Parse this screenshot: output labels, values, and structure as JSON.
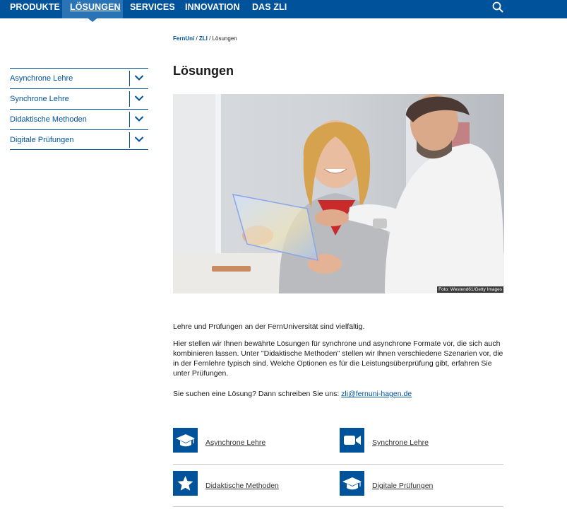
{
  "nav": {
    "items": [
      "PRODUKTE",
      "LÖSUNGEN",
      "SERVICES",
      "INNOVATION",
      "DAS ZLI"
    ],
    "active_index": 1,
    "search_icon": "search-icon",
    "bar_color": "#00529b",
    "active_color": "#2a74b5"
  },
  "breadcrumb": {
    "link1": "FernUni",
    "sep1": " / ",
    "link2": "ZLI",
    "sep2": " / ",
    "current": "Lösungen"
  },
  "sidebar": {
    "items": [
      {
        "label": "Asynchrone Lehre",
        "icon": "chevron-down-icon"
      },
      {
        "label": "Synchrone Lehre",
        "icon": "chevron-down-icon"
      },
      {
        "label": "Didaktische Methoden",
        "icon": "chevron-down-icon"
      },
      {
        "label": "Digitale Prüfungen",
        "icon": "chevron-down-icon"
      }
    ]
  },
  "main": {
    "title": "Lösungen",
    "image_caption": "Foto: Westend61/Getty Images",
    "intro": "Lehre und Prüfungen an der FernUniversität sind vielfältig.",
    "paragraph": "Hier stellen wir Ihnen bewährte Lösungen für synchrone und asynchrone Formate vor, die sich auch kombinieren lassen. Unter \"Didaktische Methoden\" stellen wir Ihnen verschiedene Szenarien vor, die in der Fernlehre typisch sind. Welche Optionen es für die Leistungsüberprüfung gibt, erfahren Sie unter Prüfungen.",
    "contact_prefix": "Sie suchen eine Lösung? Dann schreiben Sie uns: ",
    "contact_email": "zli@fernuni-hagen.de"
  },
  "tiles": [
    {
      "label": "Asynchrone Lehre",
      "icon": "graduation-cap-icon"
    },
    {
      "label": "Synchrone Lehre",
      "icon": "video-camera-icon"
    },
    {
      "label": "Didaktische Methoden",
      "icon": "star-icon"
    },
    {
      "label": "Digitale Prüfungen",
      "icon": "graduation-cap-icon"
    }
  ]
}
